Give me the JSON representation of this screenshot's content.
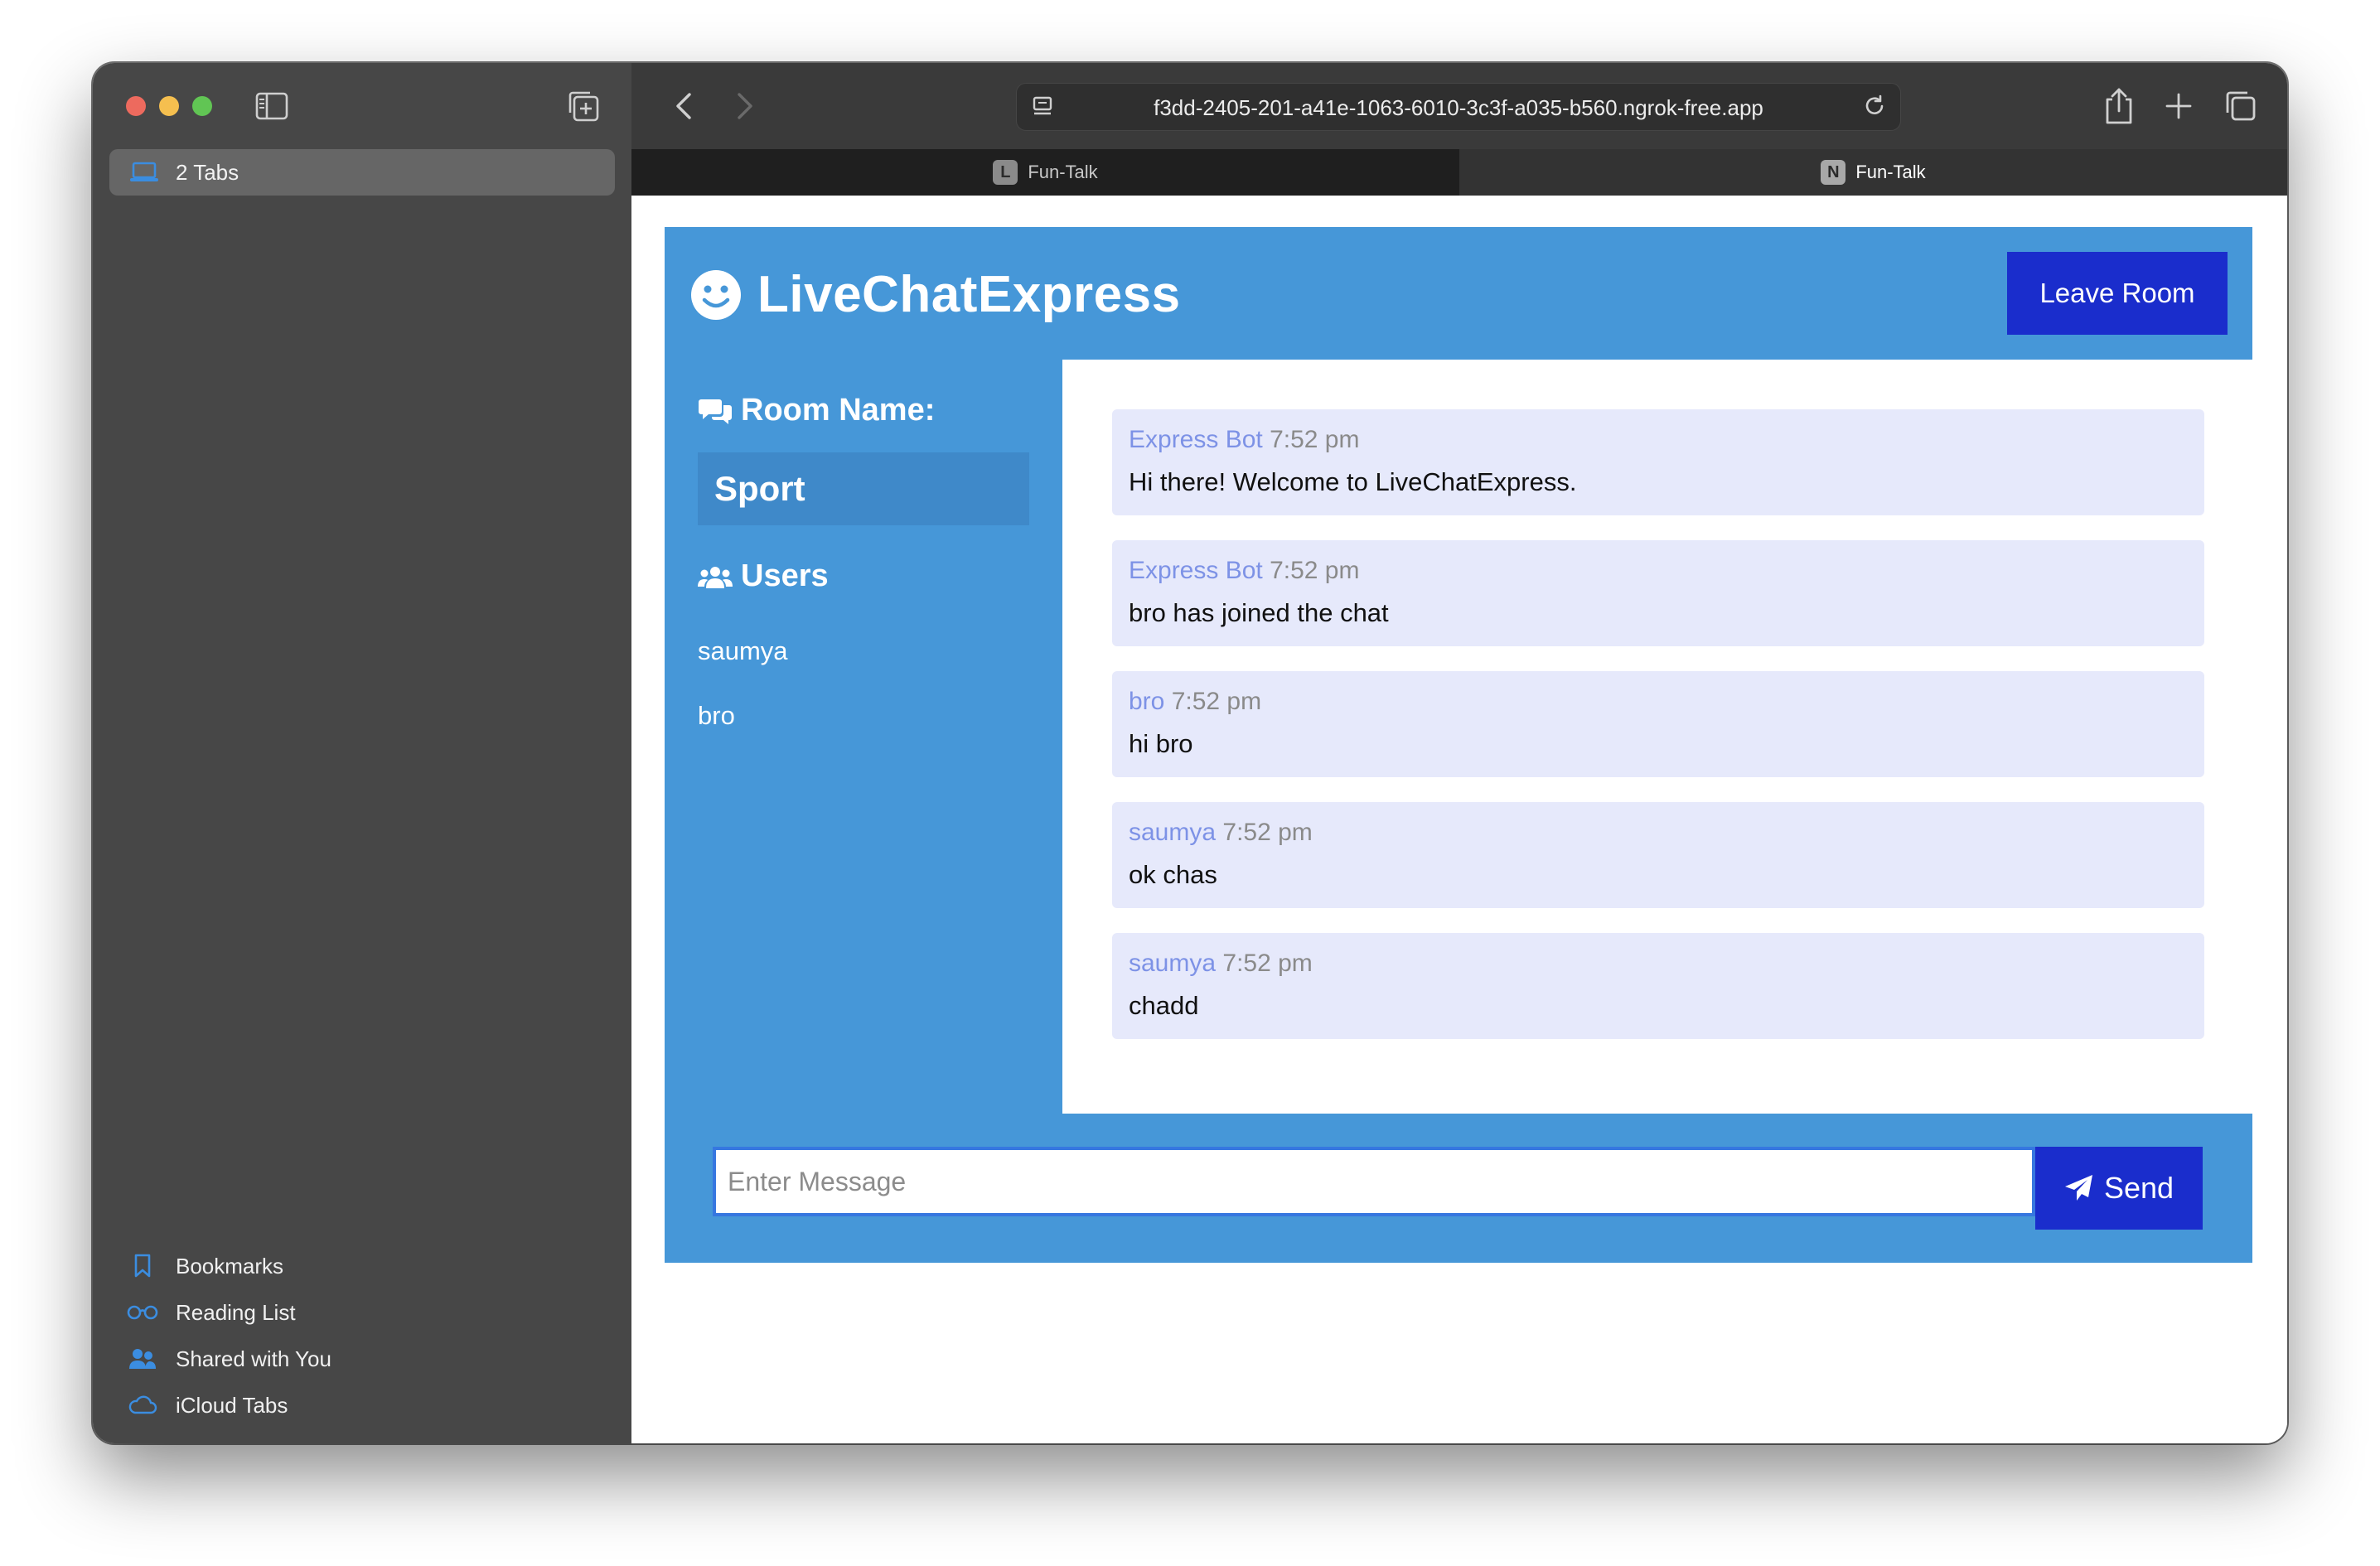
{
  "browser": {
    "sidebar": {
      "tabs_label": "2 Tabs",
      "bottom_items": [
        {
          "label": "Bookmarks",
          "icon": "bookmark-icon"
        },
        {
          "label": "Reading List",
          "icon": "glasses-icon"
        },
        {
          "label": "Shared with You",
          "icon": "people-icon"
        },
        {
          "label": "iCloud Tabs",
          "icon": "cloud-icon"
        }
      ]
    },
    "url": "f3dd-2405-201-a41e-1063-6010-3c3f-a035-b560.ngrok-free.app",
    "tabs": [
      {
        "favicon": "L",
        "title": "Fun-Talk",
        "active": false
      },
      {
        "favicon": "N",
        "title": "Fun-Talk",
        "active": true
      }
    ],
    "accent": "#3b8de0"
  },
  "app": {
    "title": "LiveChatExpress",
    "leave_label": "Leave Room",
    "room_heading": "Room Name:",
    "room_name": "Sport",
    "users_heading": "Users",
    "users": [
      "saumya",
      "bro"
    ],
    "messages": [
      {
        "user": "Express Bot",
        "time": "7:52 pm",
        "text": "Hi there! Welcome to LiveChatExpress."
      },
      {
        "user": "Express Bot",
        "time": "7:52 pm",
        "text": "bro has joined the chat"
      },
      {
        "user": "bro",
        "time": "7:52 pm",
        "text": "hi bro"
      },
      {
        "user": "saumya",
        "time": "7:52 pm",
        "text": "ok chas"
      },
      {
        "user": "saumya",
        "time": "7:52 pm",
        "text": "chadd"
      }
    ],
    "input_placeholder": "Enter Message",
    "send_label": "Send",
    "colors": {
      "panel": "#4697d8",
      "button": "#1a2dcc",
      "message_bg": "#e6e9fb",
      "username": "#7d92e6"
    }
  }
}
